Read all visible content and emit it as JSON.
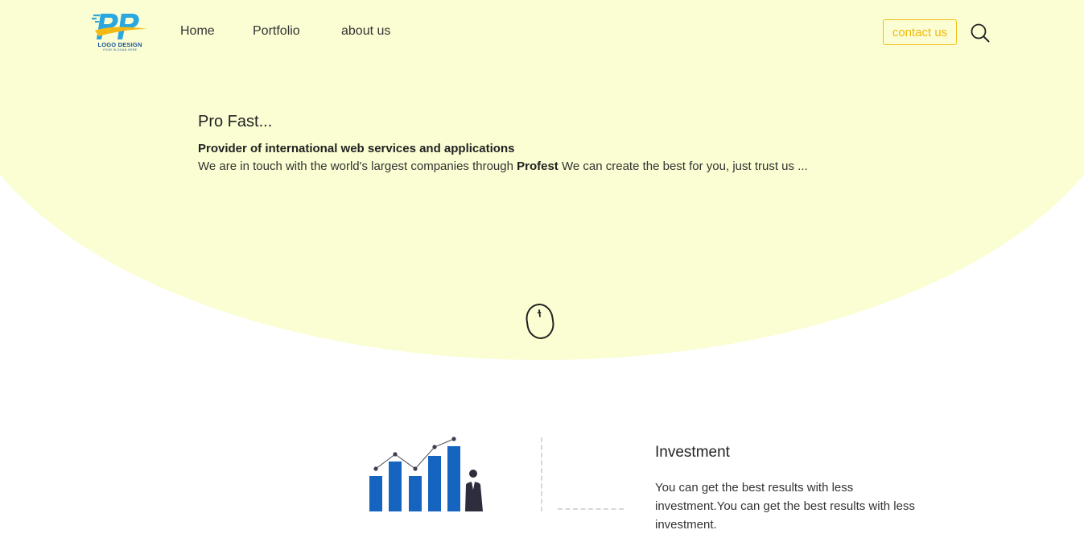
{
  "logo": {
    "text": "LOGO DESIGN",
    "slogan": "YOUR SLOGAN HERE",
    "icon": "pp-logo-icon"
  },
  "nav": {
    "items": [
      {
        "label": "Home"
      },
      {
        "label": "Portfolio"
      },
      {
        "label": "about us"
      }
    ],
    "contact_label": "contact us",
    "search_icon": "search-icon"
  },
  "hero": {
    "title": "Pro Fast...",
    "subtitle": "Provider of international web services and applications",
    "desc_before": "We are in touch with the world's largest companies through ",
    "desc_bold": "Profest",
    "desc_after": " We can create the best for you, just trust us ...",
    "scroll_icon": "mouse-scroll-icon"
  },
  "section": {
    "title": "Investment",
    "text": "You can get the best results with less investment.You can get the best results with less investment."
  },
  "colors": {
    "hero_background": "#fafed2",
    "accent": "#f2b80e",
    "chart_blue": "#1565c0",
    "logo_blue": "#15529a"
  }
}
